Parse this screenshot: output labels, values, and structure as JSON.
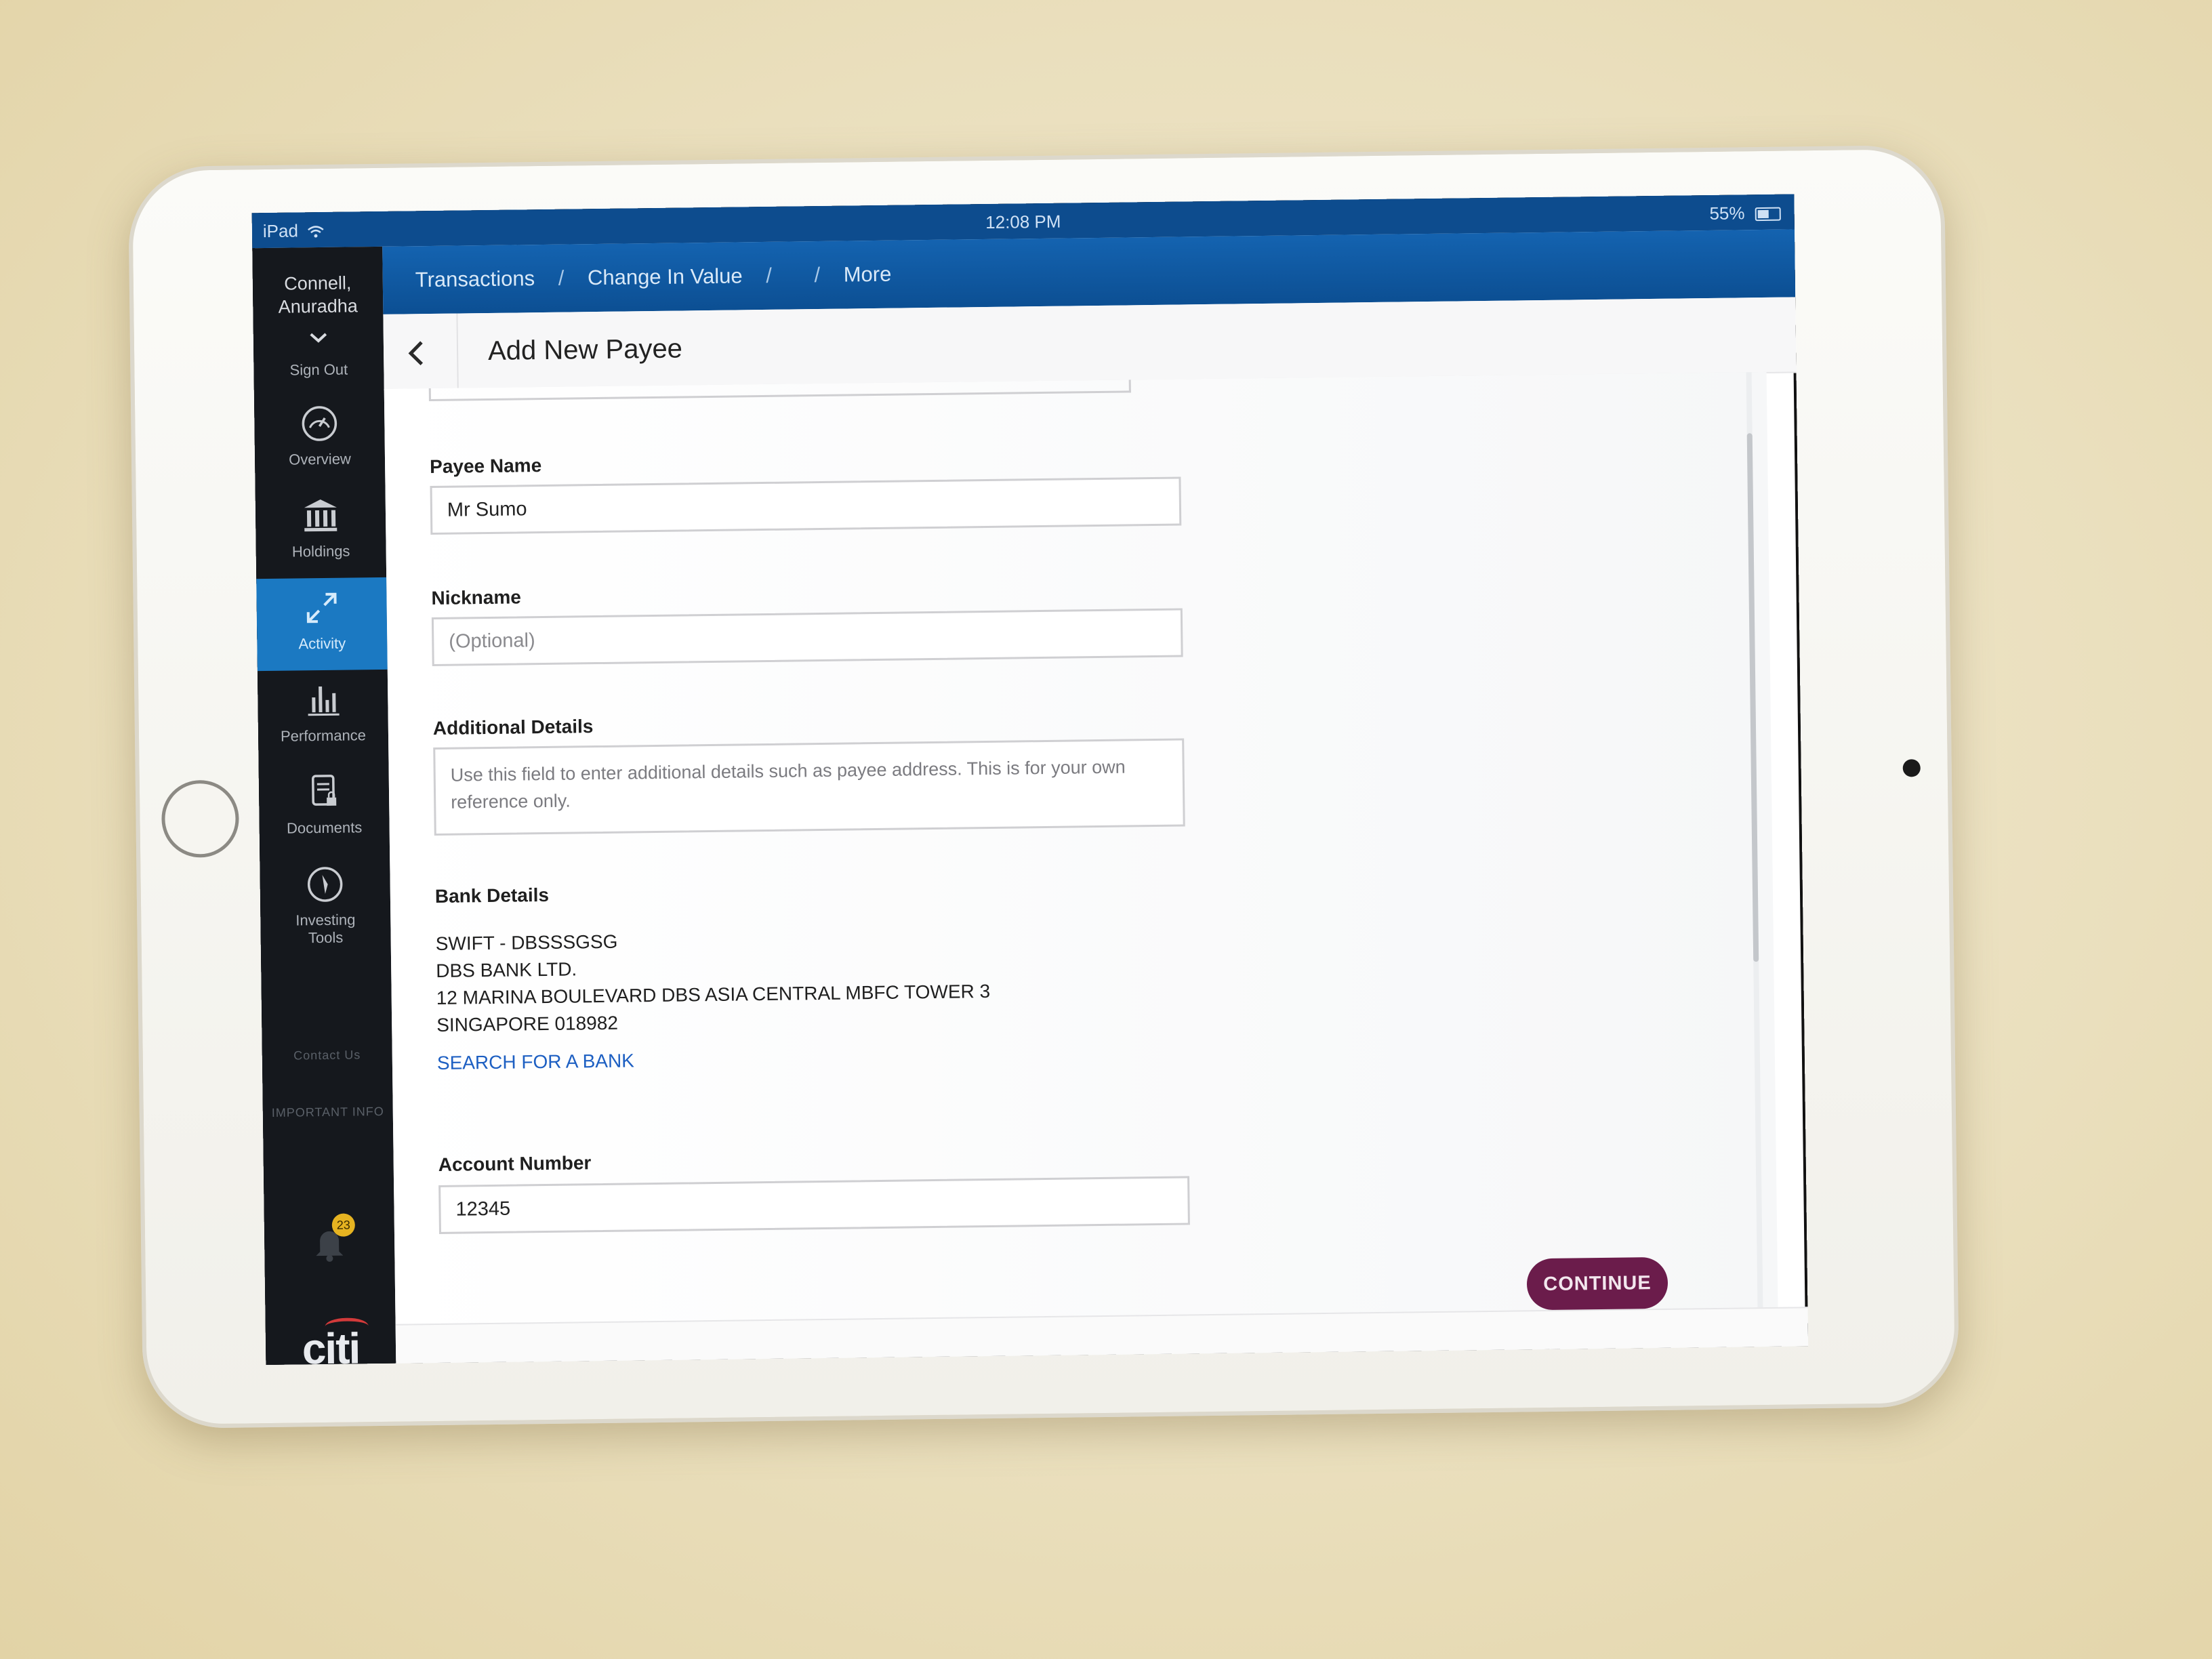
{
  "status_bar": {
    "device": "iPad",
    "time": "12:08 PM",
    "battery": "55%"
  },
  "sidebar": {
    "user_line1": "Connell,",
    "user_line2": "Anuradha",
    "sign_out": "Sign Out",
    "items": [
      {
        "label": "Overview",
        "icon": "gauge-icon"
      },
      {
        "label": "Holdings",
        "icon": "bank-icon"
      },
      {
        "label": "Activity",
        "icon": "arrows-icon",
        "active": true
      },
      {
        "label": "Performance",
        "icon": "bar-chart-icon"
      },
      {
        "label": "Documents",
        "icon": "document-lock-icon"
      },
      {
        "label_line1": "Investing",
        "label_line2": "Tools",
        "icon": "compass-icon"
      }
    ],
    "contact_us": "Contact Us",
    "important_info": "IMPORTANT INFO",
    "notification_count": "23",
    "logo": "citi"
  },
  "topnav": {
    "crumbs": [
      "Transactions",
      "Change In Value",
      "More"
    ]
  },
  "header": {
    "title": "Add New Payee"
  },
  "form": {
    "payee_name_label": "Payee Name",
    "payee_name_value": "Mr Sumo",
    "nickname_label": "Nickname",
    "nickname_placeholder": "(Optional)",
    "additional_label": "Additional Details",
    "additional_placeholder": "Use this field to enter additional details such as payee address. This is for your own reference only.",
    "bank_label": "Bank Details",
    "bank_lines": [
      "SWIFT - DBSSSGSG",
      "DBS BANK LTD.",
      "12 MARINA BOULEVARD DBS ASIA CENTRAL MBFC TOWER 3",
      "SINGAPORE 018982"
    ],
    "search_bank": "SEARCH FOR A BANK",
    "account_label": "Account Number",
    "account_value": "12345"
  },
  "footer": {
    "continue": "CONTINUE"
  },
  "colors": {
    "nav_blue": "#0c4f93",
    "active_blue": "#1b79c2",
    "sidebar_bg": "#15181d",
    "continue_bg": "#6b1c4b",
    "link_blue": "#1d5fc2"
  }
}
